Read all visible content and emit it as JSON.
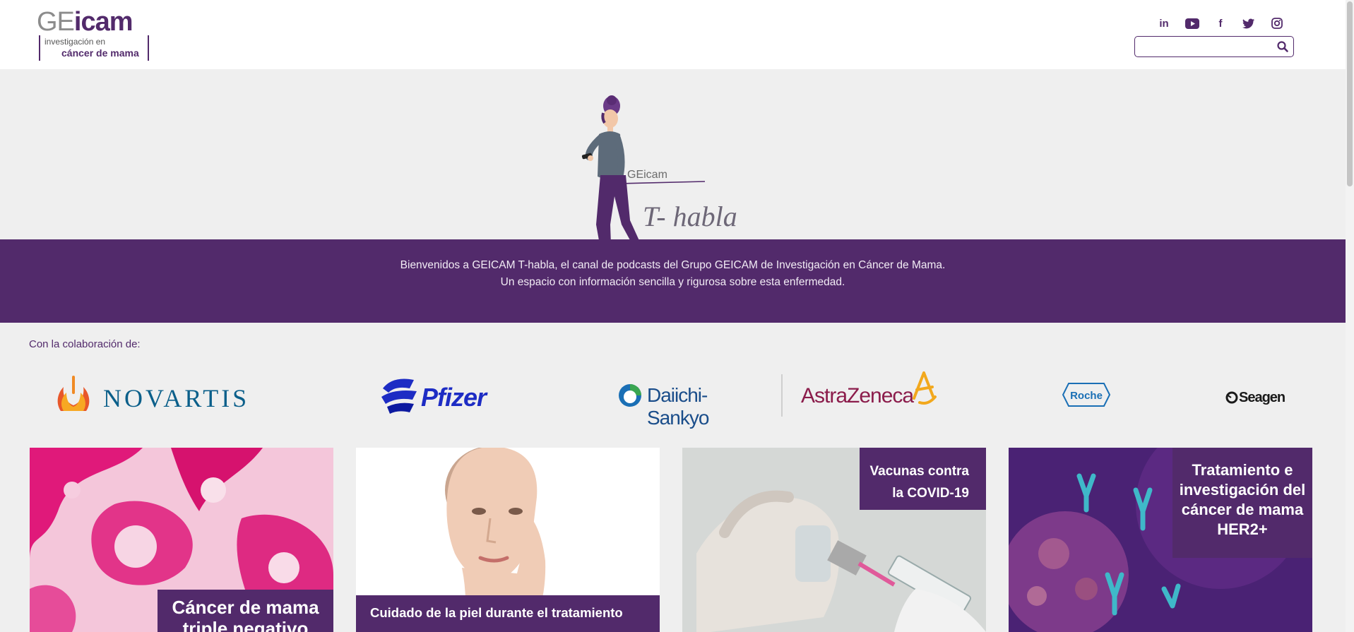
{
  "header": {
    "logo": {
      "word_ge": "GE",
      "word_icam": "icam",
      "sub_line1": "investigación en",
      "sub_line2": "cáncer de mama"
    },
    "social": [
      {
        "name": "linkedin-icon",
        "glyph": "in"
      },
      {
        "name": "youtube-icon",
        "glyph": "▶"
      },
      {
        "name": "facebook-icon",
        "glyph": "f"
      },
      {
        "name": "twitter-icon",
        "glyph": "🐦"
      },
      {
        "name": "instagram-icon",
        "glyph": "◎"
      }
    ],
    "search": {
      "value": "",
      "placeholder": ""
    }
  },
  "hero": {
    "brand_small": "GEicam",
    "brand_title": "T- habla"
  },
  "welcome": {
    "line1": "Bienvenidos a GEICAM T-habla, el canal de podcasts del Grupo GEICAM de Investigación en Cáncer de Mama.",
    "line2": "Un espacio con información sencilla y rigurosa sobre esta enfermedad."
  },
  "collaboration": {
    "label": "Con la colaboración de:",
    "sponsors": {
      "novartis": "NOVARTIS",
      "pfizer": "Pfizer",
      "daiichi": "Daiichi-Sankyo",
      "astrazeneca": "AstraZeneca",
      "roche": "Roche",
      "seagen": "Seagen"
    }
  },
  "cards": [
    {
      "label": "Cáncer de mama triple negativo"
    },
    {
      "label": "Cuidado de la piel durante el tratamiento"
    },
    {
      "label": "Vacunas contra la COVID-19"
    },
    {
      "label": "Tratamiento e investigación del cáncer de mama HER2+"
    }
  ],
  "colors": {
    "brand_purple": "#522a6b",
    "background": "#efefef"
  }
}
